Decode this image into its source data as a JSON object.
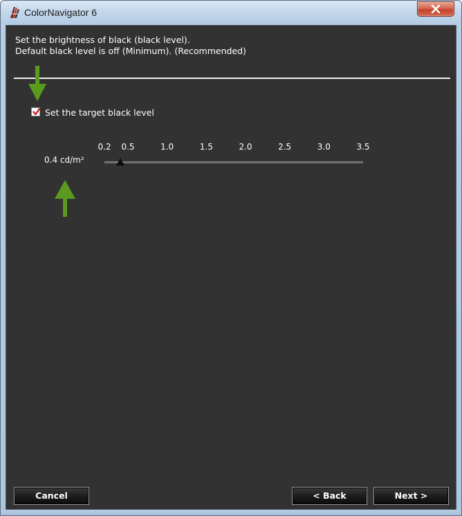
{
  "window": {
    "title": "ColorNavigator 6",
    "icon": "colornavigator-app-icon",
    "close_icon": "close-icon"
  },
  "instructions": {
    "line1": "Set the brightness of black (black level).",
    "line2": "Default black level is off (Minimum). (Recommended)"
  },
  "target_black": {
    "checkbox_label": "Set the target black level",
    "checked": true,
    "value_label": "0.4 cd/m²",
    "slider": {
      "min": 0.2,
      "max": 3.5,
      "value": 0.4,
      "ticks": [
        {
          "label": "0.2",
          "value": 0.2
        },
        {
          "label": "0.5",
          "value": 0.5
        },
        {
          "label": "1.0",
          "value": 1.0
        },
        {
          "label": "1.5",
          "value": 1.5
        },
        {
          "label": "2.0",
          "value": 2.0
        },
        {
          "label": "2.5",
          "value": 2.5
        },
        {
          "label": "3.0",
          "value": 3.0
        },
        {
          "label": "3.5",
          "value": 3.5
        }
      ]
    }
  },
  "buttons": {
    "cancel": "Cancel",
    "back": "< Back",
    "next": "Next >"
  },
  "colors": {
    "client_bg": "#323232",
    "annotation_arrow": "#5a9a1e",
    "checkmark": "#c8201c"
  }
}
